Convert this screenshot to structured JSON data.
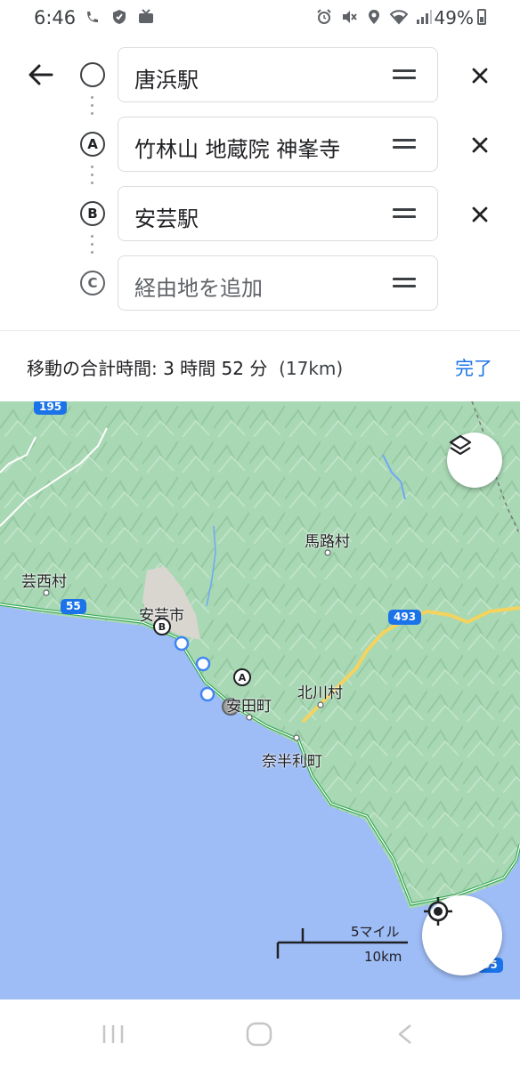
{
  "status_bar": {
    "time": "6:46",
    "battery_text": "49%",
    "left_icons": [
      "wifi-calling-icon",
      "shield-icon",
      "tv-icon"
    ],
    "right_icons": [
      "alarm-icon",
      "mute-icon",
      "location-icon",
      "wifi-icon",
      "signal-icon",
      "battery-icon"
    ]
  },
  "route": {
    "stops": [
      {
        "marker": "",
        "text": "唐浜駅",
        "is_placeholder": false
      },
      {
        "marker": "A",
        "text": "竹林山 地蔵院 神峯寺",
        "is_placeholder": false
      },
      {
        "marker": "B",
        "text": "安芸駅",
        "is_placeholder": false
      },
      {
        "marker": "C",
        "text": "経由地を追加",
        "is_placeholder": true
      }
    ]
  },
  "summary": {
    "label": "移動の合計時間: 3 時間 52 分",
    "distance": "(17km)",
    "done": "完了"
  },
  "map": {
    "place_labels": {
      "umaji": "馬路村",
      "geisei": "芸西村",
      "aki": "安芸市",
      "kitagawa": "北川村",
      "yasuda": "安田町",
      "nahari": "奈半利町"
    },
    "route_shields": {
      "r195": "195",
      "r55_west": "55",
      "r493": "493",
      "r55_south": "55"
    },
    "pins": {
      "a": "A",
      "b": "B"
    },
    "scale": {
      "top": "5マイル",
      "bottom": "10km"
    }
  },
  "colors": {
    "land": "#a9d8b4",
    "sea": "#9ebcf5",
    "route_blue": "#1a73e8",
    "accent": "#1a73e8"
  }
}
